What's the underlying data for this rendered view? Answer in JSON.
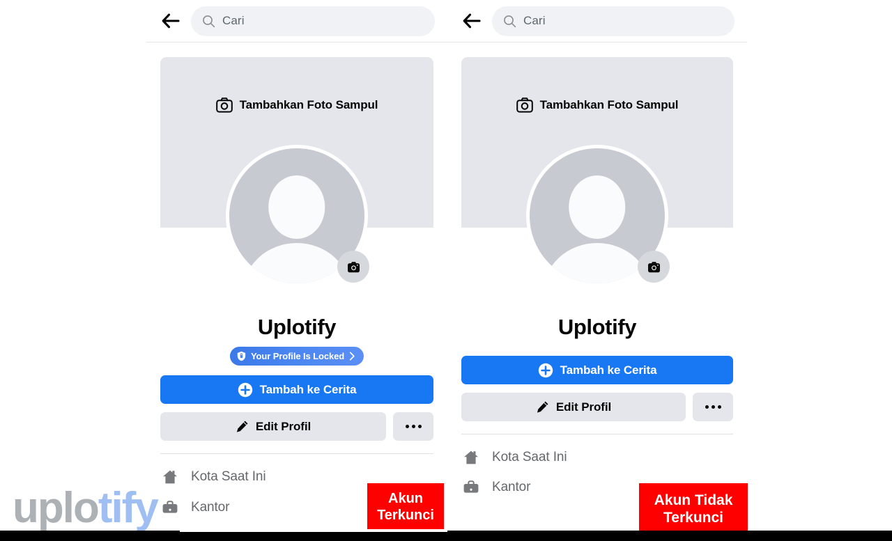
{
  "app": {
    "title": "Facebook Profile Comparison",
    "brand_watermark": {
      "part1": "uplo",
      "part2": "tify"
    }
  },
  "colors": {
    "primary_blue": "#1877f2",
    "badge_blue": "#4a86f0",
    "annotation_red": "#fe0000",
    "cover_gray": "#e4e6eb",
    "secondary_gray": "#e4e6eb",
    "muted_text": "#65676b"
  },
  "search": {
    "placeholder": "Cari",
    "back_icon": "arrow-left-icon",
    "search_icon": "search-icon"
  },
  "panels": [
    {
      "id": "locked",
      "cover": {
        "cta_label": "Tambahkan Foto Sampul",
        "icon": "camera-icon"
      },
      "avatar": {
        "alt": "default-avatar",
        "camera_button_icon": "camera-icon"
      },
      "name": "Uplotify",
      "locked_badge": {
        "label": "Your Profile Is Locked",
        "shield_icon": "shield-lock-icon",
        "chevron_icon": "chevron-right-icon",
        "visible": true
      },
      "primary_button": {
        "label": "Tambah ke Cerita",
        "icon": "plus-circle-icon"
      },
      "secondary_button": {
        "label": "Edit Profil",
        "icon": "pencil-icon"
      },
      "more_button": {
        "label": "...",
        "icon": "ellipsis-icon"
      },
      "info_rows": [
        {
          "icon": "home-icon",
          "label": "Kota Saat Ini"
        },
        {
          "icon": "briefcase-icon",
          "label": "Kantor"
        }
      ]
    },
    {
      "id": "unlocked",
      "cover": {
        "cta_label": "Tambahkan Foto Sampul",
        "icon": "camera-icon"
      },
      "avatar": {
        "alt": "default-avatar",
        "camera_button_icon": "camera-icon"
      },
      "name": "Uplotify",
      "locked_badge": {
        "visible": false
      },
      "primary_button": {
        "label": "Tambah ke Cerita",
        "icon": "plus-circle-icon"
      },
      "secondary_button": {
        "label": "Edit Profil",
        "icon": "pencil-icon"
      },
      "more_button": {
        "label": "...",
        "icon": "ellipsis-icon"
      },
      "info_rows": [
        {
          "icon": "home-icon",
          "label": "Kota Saat Ini"
        },
        {
          "icon": "briefcase-icon",
          "label": "Kantor"
        }
      ]
    }
  ],
  "annotations": [
    {
      "id": "left",
      "line1": "Akun",
      "line2": "Terkunci"
    },
    {
      "id": "right",
      "line1": "Akun Tidak",
      "line2": "Terkunci"
    }
  ]
}
